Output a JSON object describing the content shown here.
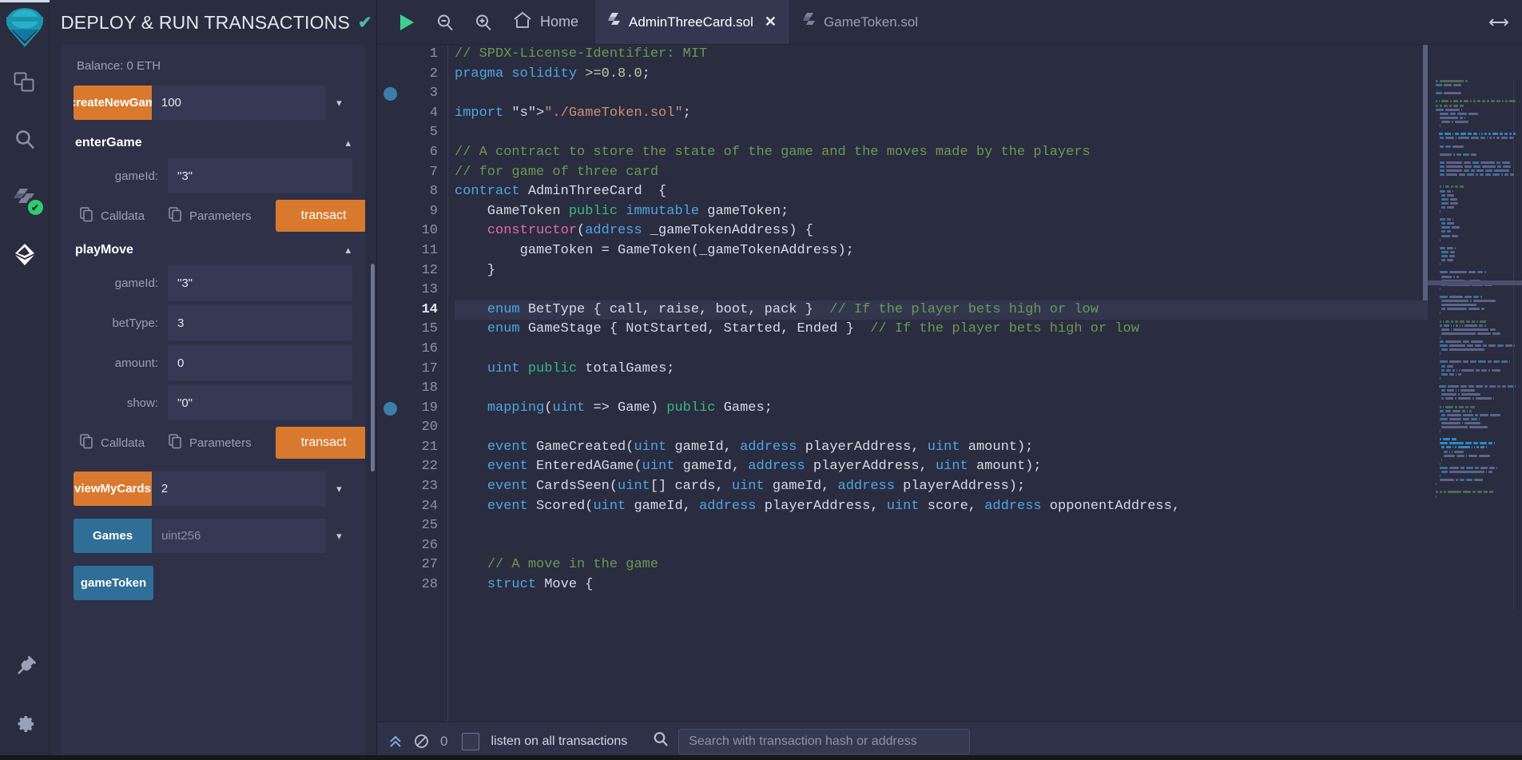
{
  "rail": {
    "logo_icon": "remix-logo-icon",
    "items": [
      {
        "icon": "file-explorer-icon",
        "name": "file-explorer"
      },
      {
        "icon": "search-icon",
        "name": "search-in-files"
      },
      {
        "icon": "solidity-compiler-icon",
        "name": "solidity-compiler",
        "badge": "✔"
      },
      {
        "icon": "deploy-run-icon",
        "name": "deploy-and-run"
      }
    ],
    "bottom_items": [
      {
        "icon": "plugin-manager-icon",
        "name": "plugin-manager"
      },
      {
        "icon": "settings-gear-icon",
        "name": "settings"
      }
    ]
  },
  "panel": {
    "title": "DEPLOY & RUN TRANSACTIONS",
    "verified_icon": "check-icon",
    "collapse_icon": "chevron-right-icon",
    "balance": "Balance: 0 ETH",
    "create_game": {
      "button_label": "createNewGam",
      "value": "100",
      "caret_icon": "chevron-down-icon"
    },
    "groups": [
      {
        "name": "enterGame",
        "toggle_icon": "chevron-up-icon",
        "params": [
          {
            "label": "gameId:",
            "value": "\"3\""
          }
        ],
        "calldata_label": "Calldata",
        "parameters_label": "Parameters",
        "copy_icon": "copy-icon",
        "transact_label": "transact"
      },
      {
        "name": "playMove",
        "toggle_icon": "chevron-up-icon",
        "params": [
          {
            "label": "gameId:",
            "value": "\"3\""
          },
          {
            "label": "betType:",
            "value": "3"
          },
          {
            "label": "amount:",
            "value": "0"
          },
          {
            "label": "show:",
            "value": "\"0\""
          }
        ],
        "calldata_label": "Calldata",
        "parameters_label": "Parameters",
        "copy_icon": "copy-icon",
        "transact_label": "transact"
      }
    ],
    "view_my_cards": {
      "button_label": "viewMyCards",
      "value": "2",
      "caret_icon": "chevron-down-icon"
    },
    "games": {
      "button_label": "Games",
      "placeholder": "uint256",
      "caret_icon": "chevron-down-icon"
    },
    "game_token": {
      "button_label": "gameToken"
    },
    "colors": {
      "orange": "#d9792e",
      "blue": "#2f6e96",
      "panel_bg": "#2e3147",
      "app_bg": "#2a2c3f"
    }
  },
  "topbar": {
    "run_icon": "play-icon",
    "zoom_out_icon": "zoom-out-icon",
    "zoom_in_icon": "zoom-in-icon",
    "home_icon": "home-icon",
    "home_label": "Home",
    "resize_icon": "horizontal-resize-icon",
    "tabs": [
      {
        "label": "AdminThreeCard.sol",
        "icon": "solidity-file-icon",
        "active": true,
        "close_icon": "close-icon"
      },
      {
        "label": "GameToken.sol",
        "icon": "solidity-file-icon",
        "active": false
      }
    ]
  },
  "editor": {
    "current_line": 14,
    "breakpoint_lines": [
      3,
      19
    ],
    "lines": [
      {
        "no": 1,
        "text": "// SPDX-License-Identifier: MIT"
      },
      {
        "no": 2,
        "text": "pragma solidity >=0.8.0;"
      },
      {
        "no": 3,
        "text": ""
      },
      {
        "no": 4,
        "text": "import \"./GameToken.sol\";"
      },
      {
        "no": 5,
        "text": ""
      },
      {
        "no": 6,
        "text": "// A contract to store the state of the game and the moves made by the players"
      },
      {
        "no": 7,
        "text": "// for game of three card"
      },
      {
        "no": 8,
        "text": "contract AdminThreeCard  {"
      },
      {
        "no": 9,
        "text": "    GameToken public immutable gameToken;"
      },
      {
        "no": 10,
        "text": "    constructor(address _gameTokenAddress) {"
      },
      {
        "no": 11,
        "text": "        gameToken = GameToken(_gameTokenAddress);"
      },
      {
        "no": 12,
        "text": "    }"
      },
      {
        "no": 13,
        "text": ""
      },
      {
        "no": 14,
        "text": "    enum BetType { call, raise, boot, pack }  // If the player bets high or low"
      },
      {
        "no": 15,
        "text": "    enum GameStage { NotStarted, Started, Ended }  // If the player bets high or low"
      },
      {
        "no": 16,
        "text": ""
      },
      {
        "no": 17,
        "text": "    uint public totalGames;"
      },
      {
        "no": 18,
        "text": ""
      },
      {
        "no": 19,
        "text": "    mapping(uint => Game) public Games;"
      },
      {
        "no": 20,
        "text": ""
      },
      {
        "no": 21,
        "text": "    event GameCreated(uint gameId, address playerAddress, uint amount);"
      },
      {
        "no": 22,
        "text": "    event EnteredAGame(uint gameId, address playerAddress, uint amount);"
      },
      {
        "no": 23,
        "text": "    event CardsSeen(uint[] cards, uint gameId, address playerAddress);"
      },
      {
        "no": 24,
        "text": "    event Scored(uint gameId, address playerAddress, uint score, address opponentAddress,"
      },
      {
        "no": 25,
        "text": ""
      },
      {
        "no": 26,
        "text": ""
      },
      {
        "no": 27,
        "text": "    // A move in the game"
      },
      {
        "no": 28,
        "text": "    struct Move {"
      }
    ]
  },
  "terminal": {
    "collapse_icon": "chevrons-up-icon",
    "clear_icon": "no-entry-icon",
    "count": "0",
    "listen_label": "listen on all transactions",
    "search_icon": "search-icon",
    "search_placeholder": "Search with transaction hash or address",
    "search_value": ""
  }
}
